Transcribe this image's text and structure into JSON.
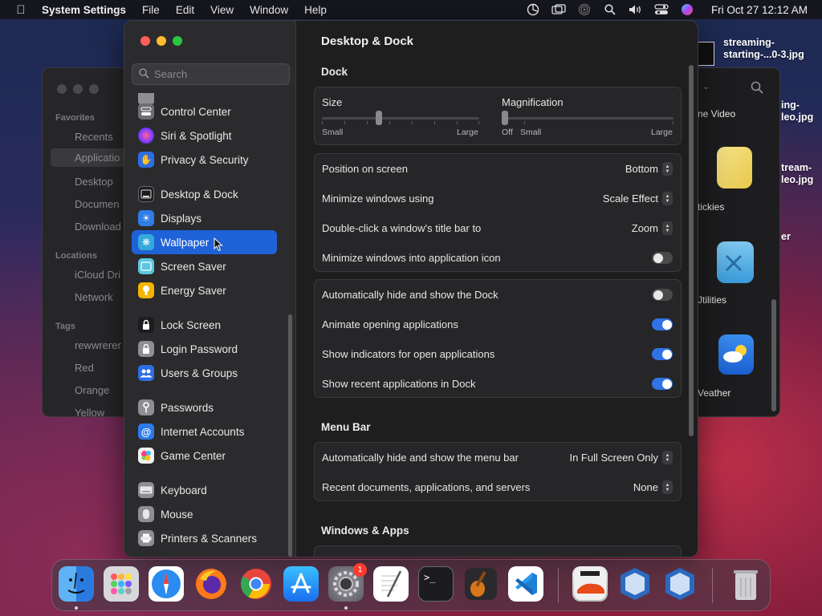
{
  "menubar": {
    "app_name": "System Settings",
    "menus": [
      "File",
      "Edit",
      "View",
      "Window",
      "Help"
    ],
    "clock": "Fri Oct 27  12:12 AM"
  },
  "finder": {
    "sidebar_sections": {
      "favorites": "Favorites",
      "locations": "Locations",
      "tags": "Tags"
    },
    "favorites": [
      "Recents",
      "Applicatio",
      "Desktop",
      "Documen",
      "Download"
    ],
    "locations": [
      "iCloud Dri",
      "Network"
    ],
    "tags": [
      "rewwrerer",
      "Red",
      "Orange",
      "Yellow"
    ],
    "apps": [
      "ne Video",
      "tickies",
      "Jtilities",
      "Veather"
    ]
  },
  "desktop_files": [
    {
      "line1": "streaming-",
      "line2": "starting-...0-3.jpg"
    },
    {
      "line1": "ing-",
      "line2": "leo.jpg"
    },
    {
      "line1": "tream-",
      "line2": "leo.jpg"
    },
    {
      "line1": "er",
      "line2": ""
    }
  ],
  "settings": {
    "search_placeholder": "Search",
    "sidebar_items": [
      {
        "label": "Control Center",
        "icon": "control-center-icon",
        "color": "#6e6e73"
      },
      {
        "label": "Siri & Spotlight",
        "icon": "siri-icon",
        "color": "#a03cc8"
      },
      {
        "label": "Privacy & Security",
        "icon": "hand-icon",
        "color": "#2d6ee6"
      },
      {
        "label": "Desktop & Dock",
        "icon": "desktop-dock-icon",
        "color": "#1c1c1e"
      },
      {
        "label": "Displays",
        "icon": "displays-icon",
        "color": "#2f7de8"
      },
      {
        "label": "Wallpaper",
        "icon": "wallpaper-icon",
        "color": "#34aadc"
      },
      {
        "label": "Screen Saver",
        "icon": "screen-saver-icon",
        "color": "#5ac8e0"
      },
      {
        "label": "Energy Saver",
        "icon": "energy-saver-icon",
        "color": "#f5b400"
      },
      {
        "label": "Lock Screen",
        "icon": "lock-icon",
        "color": "#1c1c1e"
      },
      {
        "label": "Login Password",
        "icon": "login-password-icon",
        "color": "#8e8e93"
      },
      {
        "label": "Users & Groups",
        "icon": "users-icon",
        "color": "#2d6ee6"
      },
      {
        "label": "Passwords",
        "icon": "key-icon",
        "color": "#8e8e93"
      },
      {
        "label": "Internet Accounts",
        "icon": "at-icon",
        "color": "#2d7be8"
      },
      {
        "label": "Game Center",
        "icon": "game-center-icon",
        "color": "#f2f2f2"
      },
      {
        "label": "Keyboard",
        "icon": "keyboard-icon",
        "color": "#8e8e93"
      },
      {
        "label": "Mouse",
        "icon": "mouse-icon",
        "color": "#8e8e93"
      },
      {
        "label": "Printers & Scanners",
        "icon": "printer-icon",
        "color": "#8e8e93"
      }
    ],
    "selected_item": "Wallpaper",
    "page_title": "Desktop & Dock",
    "dock_section": {
      "heading": "Dock",
      "size": {
        "label": "Size",
        "min": "Small",
        "max": "Large",
        "value": 0.36
      },
      "magnification": {
        "label": "Magnification",
        "off": "Off",
        "min": "Small",
        "max": "Large",
        "value": 0.0
      },
      "position": {
        "label": "Position on screen",
        "value": "Bottom"
      },
      "minimize_using": {
        "label": "Minimize windows using",
        "value": "Scale Effect"
      },
      "double_click": {
        "label": "Double-click a window's title bar to",
        "value": "Zoom"
      },
      "minimize_into_icon": {
        "label": "Minimize windows into application icon",
        "on": false
      },
      "autohide": {
        "label": "Automatically hide and show the Dock",
        "on": false
      },
      "animate": {
        "label": "Animate opening applications",
        "on": true
      },
      "indicators": {
        "label": "Show indicators for open applications",
        "on": true
      },
      "recent_apps": {
        "label": "Show recent applications in Dock",
        "on": true
      }
    },
    "menubar_section": {
      "heading": "Menu Bar",
      "autohide_menubar": {
        "label": "Automatically hide and show the menu bar",
        "value": "In Full Screen Only"
      },
      "recent_docs": {
        "label": "Recent documents, applications, and servers",
        "value": "None"
      }
    },
    "windows_section": {
      "heading": "Windows & Apps"
    }
  },
  "dock": {
    "apps": [
      {
        "name": "Finder",
        "icon": "finder-icon",
        "running": true
      },
      {
        "name": "Launchpad",
        "icon": "launchpad-icon",
        "running": false
      },
      {
        "name": "Safari",
        "icon": "safari-icon",
        "running": false
      },
      {
        "name": "Firefox",
        "icon": "firefox-icon",
        "running": false
      },
      {
        "name": "Chrome",
        "icon": "chrome-icon",
        "running": false
      },
      {
        "name": "App Store",
        "icon": "app-store-icon",
        "running": false
      },
      {
        "name": "System Settings",
        "icon": "system-settings-icon",
        "running": true,
        "badge": "1"
      },
      {
        "name": "TextEdit",
        "icon": "textedit-icon",
        "running": false
      },
      {
        "name": "Terminal",
        "icon": "terminal-icon",
        "running": false
      },
      {
        "name": "GarageBand",
        "icon": "garageband-icon",
        "running": false
      },
      {
        "name": "Visual Studio Code",
        "icon": "vscode-icon",
        "running": false
      },
      {
        "name": "Asphalt",
        "icon": "asphalt-icon",
        "running": false
      },
      {
        "name": "VirtualBox",
        "icon": "virtualbox-icon",
        "running": false
      },
      {
        "name": "VirtualBox 2",
        "icon": "virtualbox-icon",
        "running": false
      },
      {
        "name": "Trash",
        "icon": "trash-icon",
        "running": false
      }
    ]
  }
}
